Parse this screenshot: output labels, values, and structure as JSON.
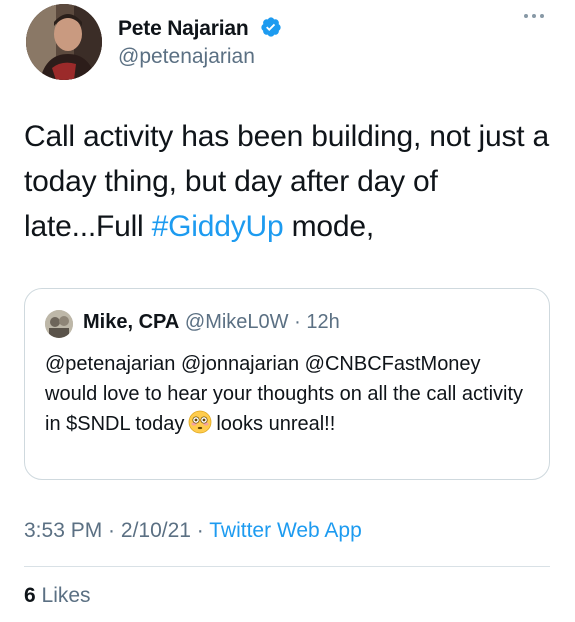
{
  "author": {
    "name": "Pete Najarian",
    "handle": "@petenajarian",
    "avatar_icon": "profile-photo",
    "verified_icon": "verified-badge-icon"
  },
  "tweet": {
    "text_before": "Call activity has been building, not just a today thing, but day after day of late...Full ",
    "hashtag": "#GiddyUp",
    "text_after": " mode,"
  },
  "quoted_tweet": {
    "name": "Mike, CPA",
    "handle": "@MikeL0W",
    "separator": "·",
    "time": "12h",
    "text_before": "@petenajarian @jonnajarian @CNBCFastMoney would love to hear your thoughts on all the call activity in $SNDL today",
    "emoji": "flushed-face-emoji",
    "text_after": "looks unreal!!"
  },
  "meta": {
    "time": "3:53 PM",
    "separator1": " · ",
    "date": "2/10/21",
    "separator2": " · ",
    "app": "Twitter Web App"
  },
  "stats": {
    "likes_count": "6",
    "likes_label": " Likes"
  },
  "colors": {
    "accent": "#1d9bf0",
    "secondary_text": "#5b7083",
    "border": "#cfd9de"
  }
}
